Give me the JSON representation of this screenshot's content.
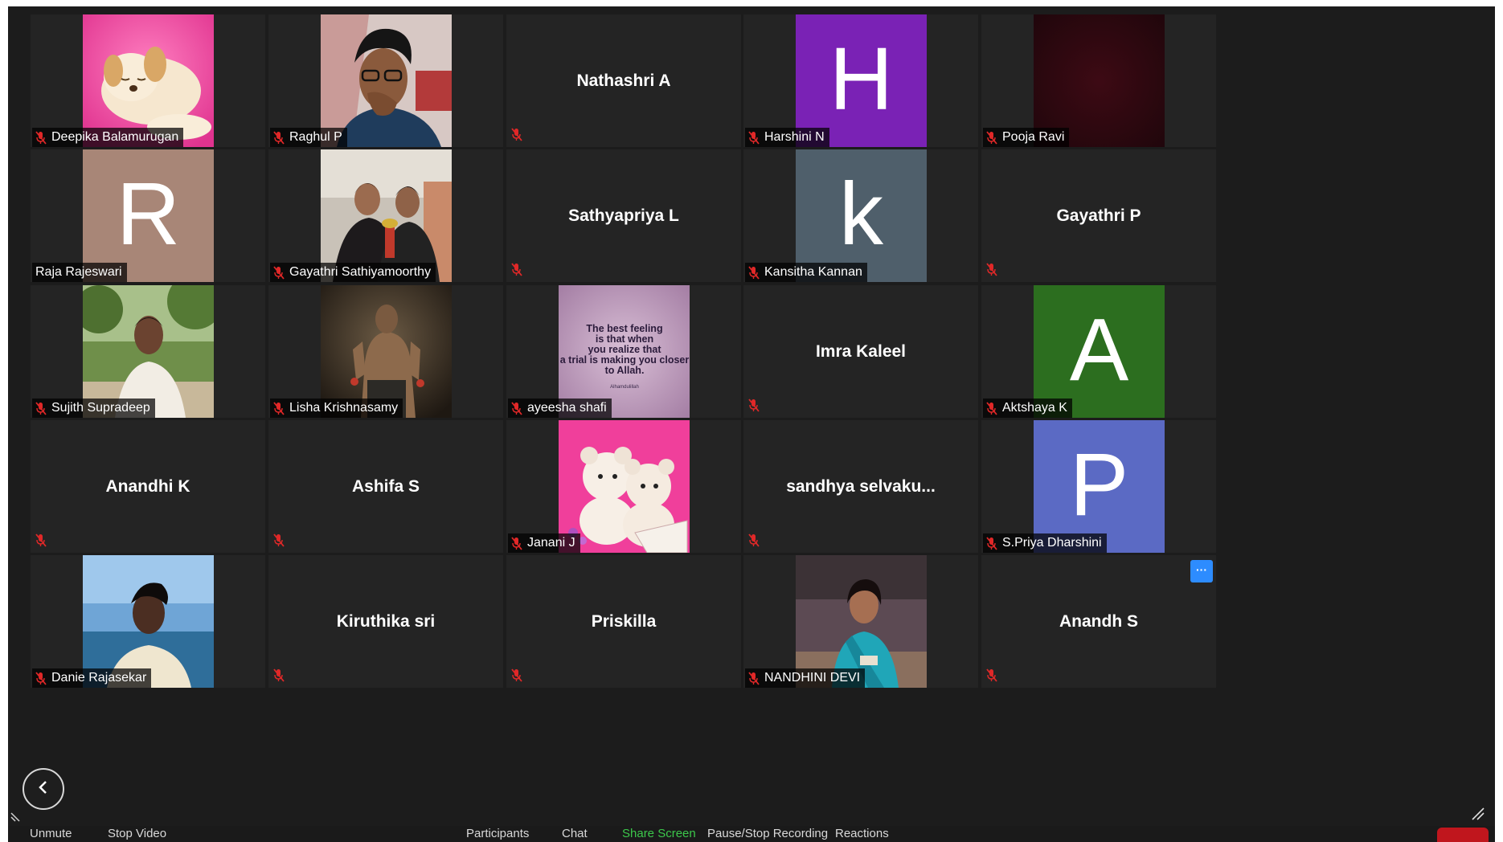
{
  "tiles": [
    {
      "name": "Deepika Balamurugan",
      "kind": "photo",
      "photo": "puppy",
      "muted": true
    },
    {
      "name": "Raghul P",
      "kind": "photo",
      "photo": "man-glasses",
      "muted": true
    },
    {
      "name": "Nathashri A",
      "kind": "name",
      "muted": true
    },
    {
      "name": "Harshini N",
      "kind": "avatar",
      "letter": "H",
      "color": "#7a22b5",
      "muted": true
    },
    {
      "name": "Pooja Ravi",
      "kind": "photo",
      "photo": "dark-red",
      "muted": true
    },
    {
      "name": "Raja Rajeswari",
      "kind": "avatar",
      "letter": "R",
      "color": "#a88677",
      "muted": false
    },
    {
      "name": "Gayathri Sathiyamoorthy",
      "kind": "photo",
      "photo": "two-girls",
      "muted": true
    },
    {
      "name": "Sathyapriya L",
      "kind": "name",
      "muted": true
    },
    {
      "name": "Kansitha Kannan",
      "kind": "avatar",
      "letter": "k",
      "color": "#4f5f6b",
      "muted": true
    },
    {
      "name": "Gayathri P",
      "kind": "name",
      "muted": true
    },
    {
      "name": "Sujith Supradeep",
      "kind": "photo",
      "photo": "man-outdoor",
      "muted": true
    },
    {
      "name": "Lisha Krishnasamy",
      "kind": "photo",
      "photo": "movie-poster",
      "muted": true
    },
    {
      "name": "ayeesha shafi",
      "kind": "photo",
      "photo": "quote",
      "muted": true
    },
    {
      "name": "Imra Kaleel",
      "kind": "name",
      "muted": true
    },
    {
      "name": "Aktshaya K",
      "kind": "avatar",
      "letter": "A",
      "color": "#2c6e1f",
      "muted": true
    },
    {
      "name": "Anandhi K",
      "kind": "name",
      "muted": true
    },
    {
      "name": "Ashifa S",
      "kind": "name",
      "muted": true
    },
    {
      "name": "Janani J",
      "kind": "photo",
      "photo": "teddy",
      "muted": true
    },
    {
      "name": "sandhya  selvaku...",
      "kind": "name",
      "muted": true
    },
    {
      "name": "S.Priya Dharshini",
      "kind": "avatar",
      "letter": "P",
      "color": "#5b6ac4",
      "muted": true
    },
    {
      "name": "Danie Rajasekar",
      "kind": "photo",
      "photo": "man-beach",
      "muted": true
    },
    {
      "name": "Kiruthika sri",
      "kind": "name",
      "muted": true
    },
    {
      "name": "Priskilla",
      "kind": "name",
      "muted": true
    },
    {
      "name": "NANDHINI DEVI",
      "kind": "photo",
      "photo": "woman-saree",
      "muted": true
    },
    {
      "name": "Anandh S",
      "kind": "name",
      "muted": true
    }
  ],
  "quote": {
    "line1": "The best feeling",
    "line2": "is that when",
    "line3": "you realize that",
    "line4": "a trial is making you closer",
    "line5": "to Allah.",
    "signature": "Alhamdulillah"
  },
  "more_button": {
    "label": "···"
  },
  "toolbar": {
    "unmute": "Unmute",
    "stop_video": "Stop Video",
    "participants": "Participants",
    "chat": "Chat",
    "share_screen": "Share Screen",
    "recording": "Pause/Stop Recording",
    "reactions": "Reactions"
  },
  "colors": {
    "background": "#1c1c1c",
    "tile": "#242424",
    "muted_icon": "#e02828",
    "share_screen": "#3cc84b",
    "accent": "#2d8cff"
  }
}
